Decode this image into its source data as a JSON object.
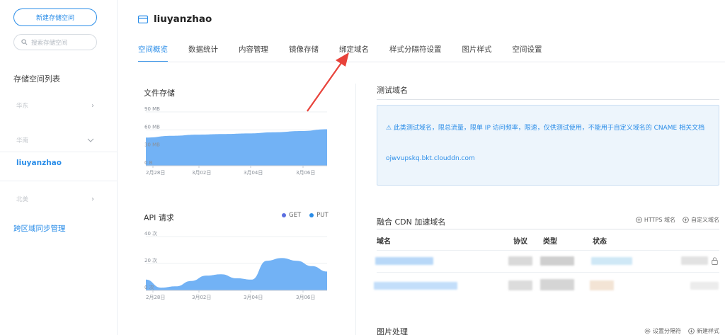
{
  "sidebar": {
    "new_bucket": "新建存储空间",
    "search_placeholder": "搜索存储空间",
    "list_title": "存储空间列表",
    "regions": [
      {
        "label": "华东",
        "chevron": "chevron-right-icon"
      },
      {
        "label": "华南",
        "chevron": "chevron-down-icon"
      },
      {
        "label": "北美",
        "chevron": "chevron-right-icon"
      }
    ],
    "active_bucket": "liuyanzhao",
    "cross_region": "跨区域同步管理"
  },
  "header": {
    "bucket_name": "liuyanzhao",
    "tabs": [
      {
        "label": "空间概览",
        "active": true
      },
      {
        "label": "数据统计"
      },
      {
        "label": "内容管理"
      },
      {
        "label": "镜像存储"
      },
      {
        "label": "绑定域名"
      },
      {
        "label": "样式分隔符设置"
      },
      {
        "label": "图片样式"
      },
      {
        "label": "空间设置"
      }
    ]
  },
  "storage_chart": {
    "title": "文件存储",
    "chart_data": {
      "type": "area",
      "x": [
        "2月28日",
        "3月02日",
        "3月04日",
        "3月06日"
      ],
      "ytick_labels": [
        "90 MB",
        "60 MB",
        "30 MB",
        "0 B"
      ],
      "yticks": [
        90,
        60,
        30,
        0
      ],
      "ylim": [
        0,
        90
      ],
      "values": [
        47,
        50,
        52,
        53,
        54,
        56,
        58,
        61
      ],
      "color": "#6aaef4"
    }
  },
  "api_chart": {
    "title": "API 请求",
    "legend": [
      {
        "name": "GET",
        "color": "#5b6ee0"
      },
      {
        "name": "PUT",
        "color": "#2a8de8"
      }
    ],
    "chart_data": {
      "type": "area",
      "x": [
        "2月28日",
        "3月02日",
        "3月04日",
        "3月06日"
      ],
      "ytick_labels": [
        "40 次",
        "20 次",
        "0 次"
      ],
      "yticks": [
        40,
        20,
        0
      ],
      "ylim": [
        0,
        40
      ],
      "values": [
        8,
        2,
        3,
        7,
        11,
        12,
        9,
        8,
        22,
        24,
        22,
        18,
        14
      ],
      "color": "#6aaef4"
    }
  },
  "test_domain": {
    "title": "测试域名",
    "notice": "⚠ 此类测试域名，限总流量，限单 IP 访问频率，限速，仅供测试使用，不能用于自定义域名的 CNAME 相关文档",
    "domain": "ojwvupskq.bkt.clouddn.com"
  },
  "cdn": {
    "title": "融合 CDN 加速域名",
    "actions": [
      "HTTPS 域名",
      "自定义域名"
    ],
    "columns": [
      "域名",
      "协议",
      "类型",
      "状态"
    ]
  },
  "image_processing": {
    "title": "图片处理",
    "actions": [
      "设置分隔符",
      "新建样式"
    ]
  },
  "colors": {
    "accent": "#2a8de8",
    "area_fill": "#6aaef4",
    "annotation_arrow": "#e8423a"
  }
}
